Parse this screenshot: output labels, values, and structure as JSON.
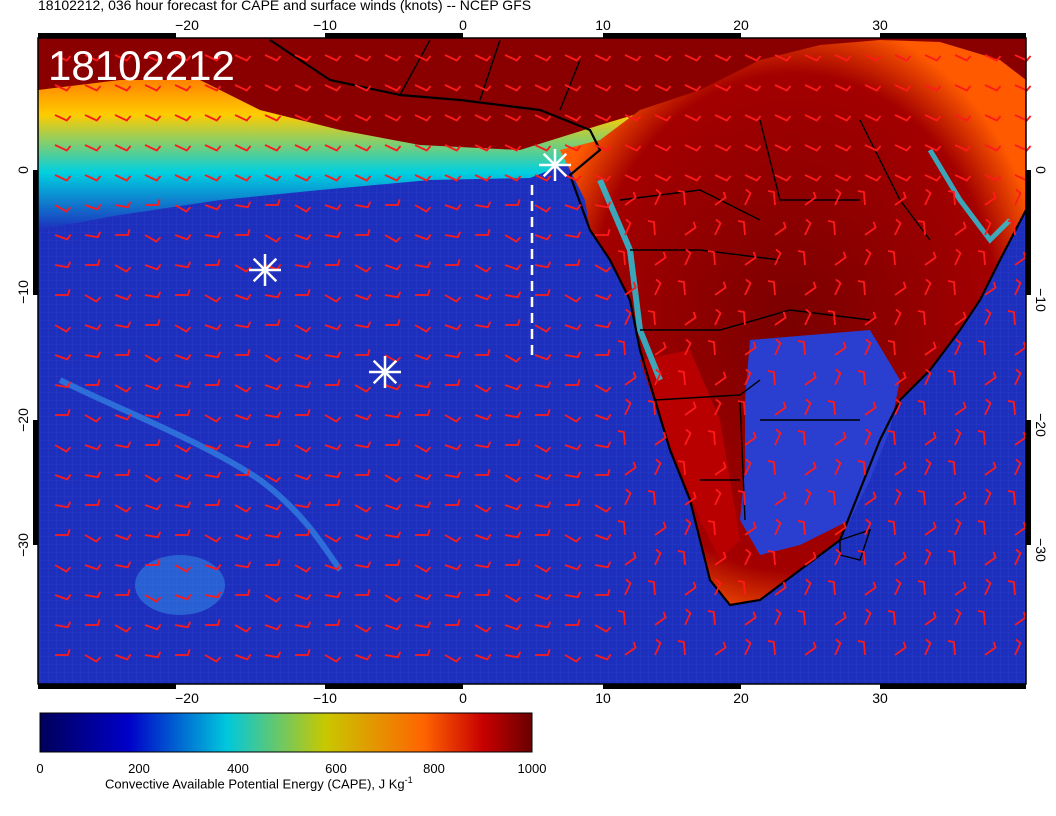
{
  "header": {
    "title": "18102212, 036 hour forecast for CAPE and surface winds (knots) -- NCEP GFS"
  },
  "map": {
    "stamp": "18102212",
    "colors": {
      "ocean": "#1d2fbd",
      "land_high": "#7a0000",
      "wind_barbs": "#ff1a1a",
      "coast": "#000000",
      "marker": "#ffffff"
    },
    "lon_ticks": [
      "−20",
      "−10",
      "0",
      "10",
      "20",
      "30"
    ],
    "lat_ticks": [
      "0",
      "−10",
      "−20",
      "−30"
    ],
    "markers_icon": "asterisk-icon",
    "wind_icon": "wind-barb-icon"
  },
  "colorbar": {
    "ticks": [
      "0",
      "200",
      "400",
      "600",
      "800",
      "1000"
    ],
    "label": "Convective Available Potential Energy (CAPE), J Kg",
    "label_sup": "-1",
    "stops": [
      "#00005a",
      "#0000c8",
      "#00c8dc",
      "#c8c800",
      "#ff6400",
      "#c80000",
      "#6a0000"
    ]
  }
}
